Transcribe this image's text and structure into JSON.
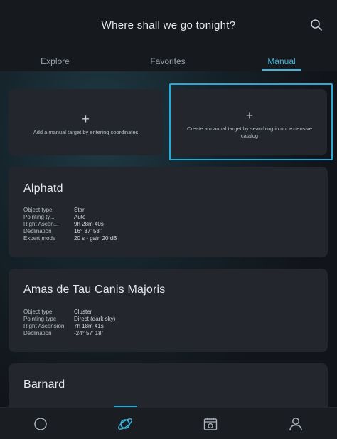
{
  "header": {
    "title": "Where shall we go tonight?",
    "search_icon": "search-icon"
  },
  "tabs": [
    {
      "label": "Explore"
    },
    {
      "label": "Favorites"
    },
    {
      "label": "Manual",
      "active": true
    }
  ],
  "add_cards": [
    {
      "plus": "+",
      "text": "Add a manual target by entering coordinates"
    },
    {
      "plus": "+",
      "text": "Create a manual target by searching in our extensive catalog",
      "selected": true
    }
  ],
  "targets": [
    {
      "name": "Alphatd",
      "props": [
        {
          "key": "Object type",
          "value": "Star"
        },
        {
          "key": "Pointing ty...",
          "value": "Auto"
        },
        {
          "key": "Right Ascen...",
          "value": "9h 28m 40s"
        },
        {
          "key": "Declination",
          "value": "16° 37' 58''"
        },
        {
          "key": "Expert mode",
          "value": "20 s - gain 20 dB"
        }
      ]
    },
    {
      "name": "Amas de Tau Canis Majoris",
      "props": [
        {
          "key": "Object type",
          "value": "Cluster"
        },
        {
          "key": "Pointing type",
          "value": "Direct (dark sky)"
        },
        {
          "key": "Right Ascension",
          "value": "7h 18m 41s"
        },
        {
          "key": "Declination",
          "value": "-24° 57' 18''"
        }
      ]
    },
    {
      "name": "Barnard",
      "props": []
    }
  ],
  "bottom_nav": [
    {
      "icon": "home-circle-icon"
    },
    {
      "icon": "planet-icon",
      "active": true
    },
    {
      "icon": "calendar-icon"
    },
    {
      "icon": "profile-icon"
    }
  ],
  "colors": {
    "accent": "#3fb6dc",
    "card": "#23262d",
    "background": "#111419"
  }
}
